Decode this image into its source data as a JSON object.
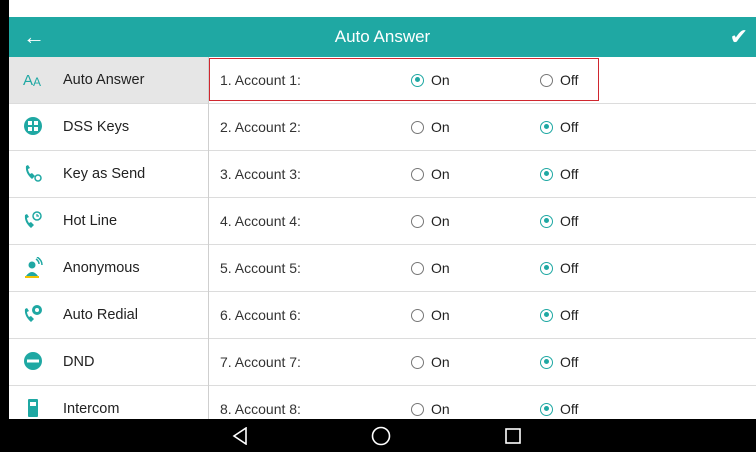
{
  "header": {
    "title": "Auto Answer",
    "back_icon": "back-arrow-icon",
    "confirm_icon": "checkmark-icon"
  },
  "sidebar": {
    "items": [
      {
        "label": "Auto Answer",
        "icon": "auto-answer-icon",
        "active": true
      },
      {
        "label": "DSS Keys",
        "icon": "dss-keys-icon",
        "active": false
      },
      {
        "label": "Key as Send",
        "icon": "key-as-send-icon",
        "active": false
      },
      {
        "label": "Hot Line",
        "icon": "hot-line-icon",
        "active": false
      },
      {
        "label": "Anonymous",
        "icon": "anonymous-icon",
        "active": false
      },
      {
        "label": "Auto Redial",
        "icon": "auto-redial-icon",
        "active": false
      },
      {
        "label": "DND",
        "icon": "dnd-icon",
        "active": false
      },
      {
        "label": "Intercom",
        "icon": "intercom-icon",
        "active": false
      }
    ]
  },
  "accounts": {
    "on_label": "On",
    "off_label": "Off",
    "rows": [
      {
        "label": "1. Account 1:",
        "selected": "On"
      },
      {
        "label": "2. Account 2:",
        "selected": "Off"
      },
      {
        "label": "3. Account 3:",
        "selected": "Off"
      },
      {
        "label": "4. Account 4:",
        "selected": "Off"
      },
      {
        "label": "5. Account 5:",
        "selected": "Off"
      },
      {
        "label": "6. Account 6:",
        "selected": "Off"
      },
      {
        "label": "7. Account 7:",
        "selected": "Off"
      },
      {
        "label": "8. Account 8:",
        "selected": "Off"
      }
    ]
  },
  "colors": {
    "accent": "#1fa8a3",
    "highlight": "#d0272f"
  },
  "navbar": {
    "back_icon": "nav-back-triangle-icon",
    "home_icon": "nav-home-circle-icon",
    "recent_icon": "nav-recent-square-icon"
  }
}
